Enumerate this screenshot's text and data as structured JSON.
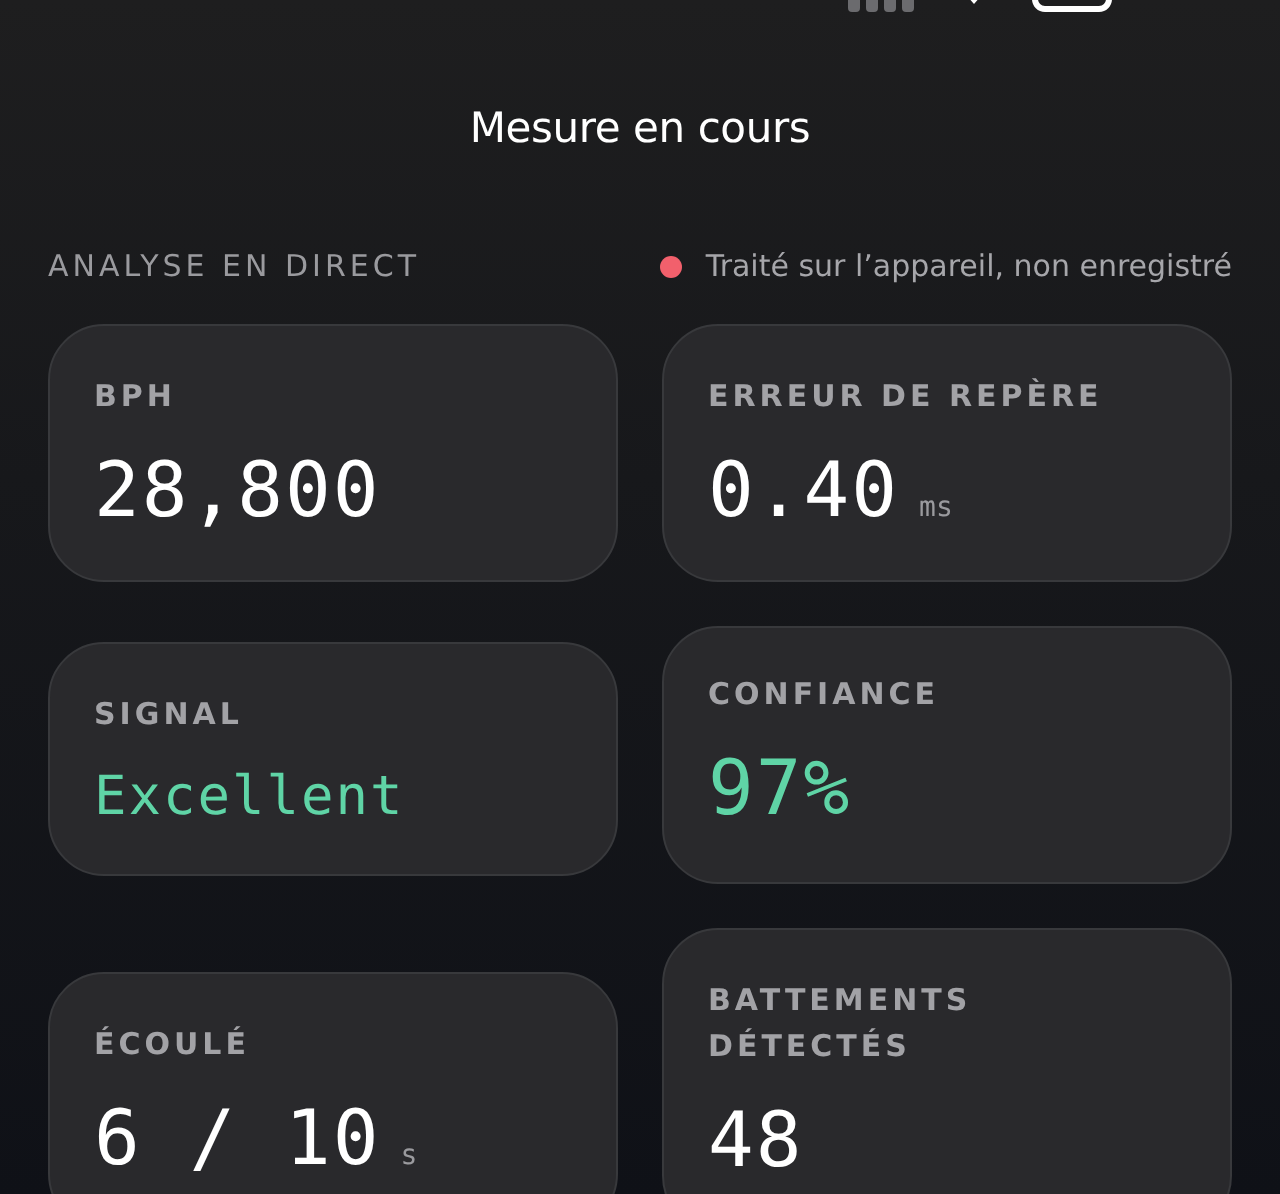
{
  "screen": {
    "title": "Mesure en cours"
  },
  "section": {
    "heading": "ANALYSE EN DIRECT",
    "status": {
      "text": "Traité sur l’appareil, non enregistré",
      "color": "#f2606c"
    }
  },
  "columns": [
    {
      "cards": [
        {
          "label": "BPH",
          "value": "28,800",
          "highlighted": false
        },
        {
          "label": "SIGNAL",
          "value": "Excellent",
          "highlighted": true
        },
        {
          "label": "ÉCOULÉ",
          "value": "6 / 10",
          "unit": "s",
          "highlighted": false
        }
      ]
    },
    {
      "cards": [
        {
          "label": "ERREUR DE REPÈRE",
          "value": "0.40",
          "unit": "ms",
          "highlighted": false
        },
        {
          "label": "CONFIANCE",
          "value": "97%",
          "highlighted": true
        },
        {
          "label": "BATTEMENTS DÉTECTÉS",
          "value": "48",
          "highlighted": false
        }
      ]
    }
  ]
}
